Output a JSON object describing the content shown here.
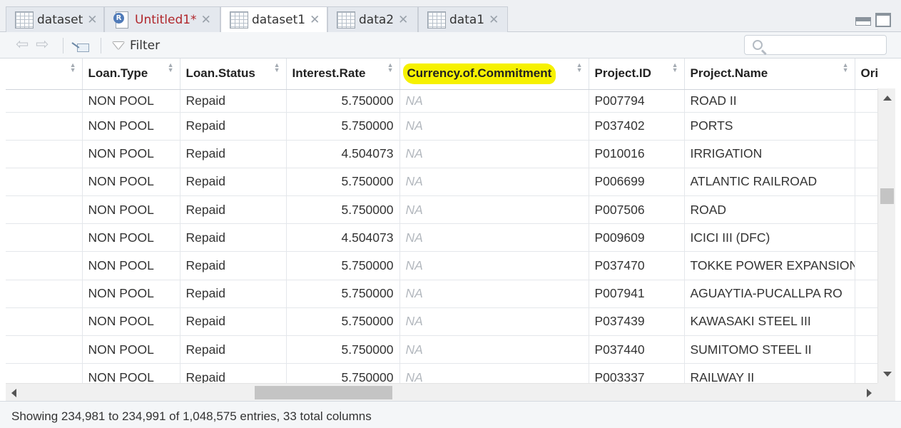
{
  "tabs": [
    {
      "label": "dataset",
      "icon": "grid-icon",
      "active": false,
      "unsaved": false
    },
    {
      "label": "Untitled1*",
      "icon": "r-script-icon",
      "active": false,
      "unsaved": true
    },
    {
      "label": "dataset1",
      "icon": "grid-icon",
      "active": true,
      "unsaved": false
    },
    {
      "label": "data2",
      "icon": "grid-icon",
      "active": false,
      "unsaved": false
    },
    {
      "label": "data1",
      "icon": "grid-icon",
      "active": false,
      "unsaved": false
    }
  ],
  "toolbar": {
    "filter_label": "Filter",
    "search_placeholder": ""
  },
  "grid": {
    "columns": [
      "",
      "Loan.Type",
      "Loan.Status",
      "Interest.Rate",
      "Currency.of.Commitment",
      "Project.ID",
      "Project.Name",
      "Origin"
    ],
    "highlighted_column": "Currency.of.Commitment",
    "highlight_color": "#f6f100",
    "rows": [
      [
        "",
        "NON POOL",
        "Repaid",
        "5.750000",
        "NA",
        "P007794",
        "ROAD II",
        ""
      ],
      [
        "",
        "NON POOL",
        "Repaid",
        "5.750000",
        "NA",
        "P037402",
        "PORTS",
        ""
      ],
      [
        "",
        "NON POOL",
        "Repaid",
        "4.504073",
        "NA",
        "P010016",
        "IRRIGATION",
        ""
      ],
      [
        "",
        "NON POOL",
        "Repaid",
        "5.750000",
        "NA",
        "P006699",
        "ATLANTIC RAILROAD",
        ""
      ],
      [
        "",
        "NON POOL",
        "Repaid",
        "5.750000",
        "NA",
        "P007506",
        "ROAD",
        ""
      ],
      [
        "",
        "NON POOL",
        "Repaid",
        "4.504073",
        "NA",
        "P009609",
        "ICICI III (DFC)",
        ""
      ],
      [
        "",
        "NON POOL",
        "Repaid",
        "5.750000",
        "NA",
        "P037470",
        "TOKKE POWER EXPANSION",
        ""
      ],
      [
        "",
        "NON POOL",
        "Repaid",
        "5.750000",
        "NA",
        "P007941",
        "AGUAYTIA-PUCALLPA RO",
        ""
      ],
      [
        "",
        "NON POOL",
        "Repaid",
        "5.750000",
        "NA",
        "P037439",
        "KAWASAKI STEEL III",
        ""
      ],
      [
        "",
        "NON POOL",
        "Repaid",
        "5.750000",
        "NA",
        "P037440",
        "SUMITOMO STEEL II",
        ""
      ],
      [
        "",
        "NON POOL",
        "Repaid",
        "5.750000",
        "NA",
        "P003337",
        "RAILWAY II",
        ""
      ]
    ]
  },
  "status": {
    "text": "Showing 234,981 to 234,991 of 1,048,575 entries, 33 total columns"
  }
}
